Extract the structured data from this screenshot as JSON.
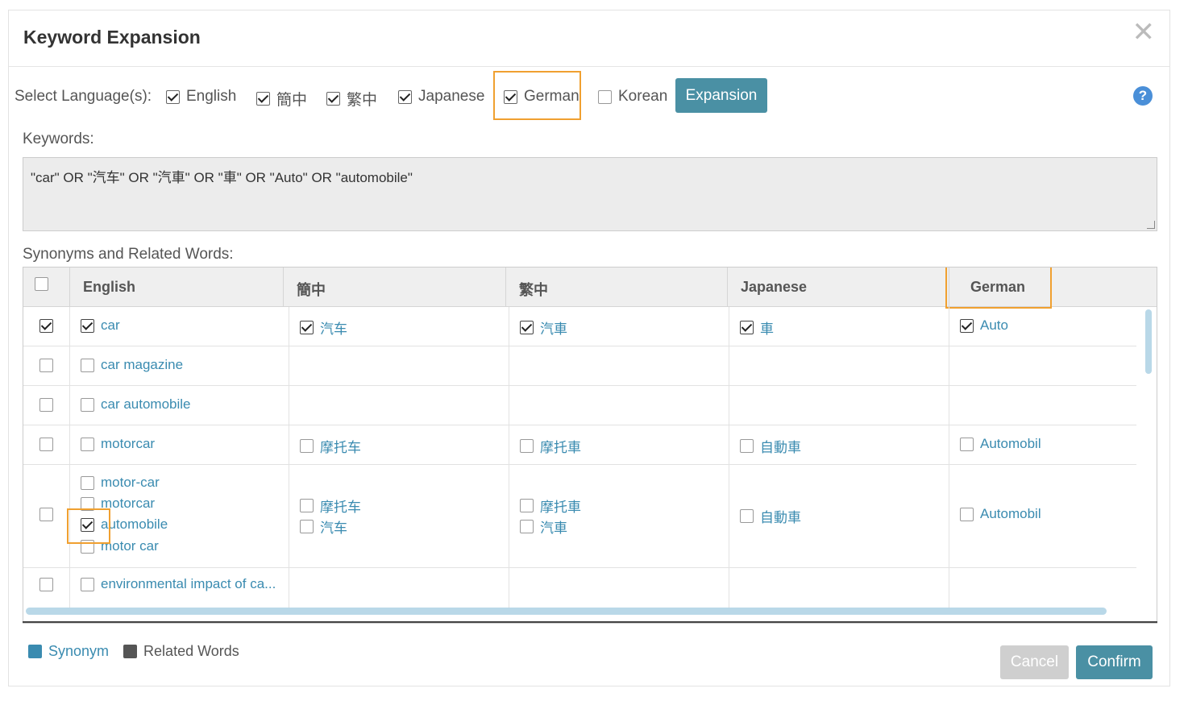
{
  "modal": {
    "title": "Keyword Expansion",
    "close_label": "✕"
  },
  "language_select": {
    "label": "Select Language(s):",
    "options": [
      {
        "label": "English",
        "checked": true
      },
      {
        "label": "簡中",
        "checked": true
      },
      {
        "label": "繁中",
        "checked": true
      },
      {
        "label": "Japanese",
        "checked": true
      },
      {
        "label": "German",
        "checked": true
      },
      {
        "label": "Korean",
        "checked": false
      }
    ],
    "expansion_button": "Expansion",
    "help_label": "?"
  },
  "keywords": {
    "label": "Keywords:",
    "value": "\"car\" OR \"汽车\" OR \"汽車\" OR \"車\" OR \"Auto\" OR \"automobile\""
  },
  "synonyms": {
    "label": "Synonyms and Related Words:",
    "columns": [
      "English",
      "簡中",
      "繁中",
      "Japanese",
      "German"
    ],
    "rows": [
      {
        "selected": true,
        "english": [
          {
            "text": "car",
            "checked": true
          }
        ],
        "zh_cn": [
          {
            "text": "汽车",
            "checked": true
          }
        ],
        "zh_tw": [
          {
            "text": "汽車",
            "checked": true
          }
        ],
        "japanese": [
          {
            "text": "車",
            "checked": true
          }
        ],
        "german": [
          {
            "text": "Auto",
            "checked": true
          }
        ]
      },
      {
        "selected": false,
        "english": [
          {
            "text": "car magazine",
            "checked": false
          }
        ],
        "zh_cn": [],
        "zh_tw": [],
        "japanese": [],
        "german": []
      },
      {
        "selected": false,
        "english": [
          {
            "text": "car automobile",
            "checked": false
          }
        ],
        "zh_cn": [],
        "zh_tw": [],
        "japanese": [],
        "german": []
      },
      {
        "selected": false,
        "english": [
          {
            "text": "motorcar",
            "checked": false
          }
        ],
        "zh_cn": [
          {
            "text": "摩托车",
            "checked": false
          }
        ],
        "zh_tw": [
          {
            "text": "摩托車",
            "checked": false
          }
        ],
        "japanese": [
          {
            "text": "自動車",
            "checked": false
          }
        ],
        "german": [
          {
            "text": "Automobil",
            "checked": false
          }
        ]
      },
      {
        "selected": false,
        "english": [
          {
            "text": "motor-car",
            "checked": false
          },
          {
            "text": "motorcar",
            "checked": false
          },
          {
            "text": "automobile",
            "checked": true
          },
          {
            "text": "motor car",
            "checked": false
          }
        ],
        "zh_cn": [
          {
            "text": "摩托车",
            "checked": false
          },
          {
            "text": "汽车",
            "checked": false
          }
        ],
        "zh_tw": [
          {
            "text": "摩托車",
            "checked": false
          },
          {
            "text": "汽車",
            "checked": false
          }
        ],
        "japanese": [
          {
            "text": "自動車",
            "checked": false
          }
        ],
        "german": [
          {
            "text": "Automobil",
            "checked": false
          }
        ]
      },
      {
        "selected": false,
        "english": [
          {
            "text": "environmental impact of ca...",
            "checked": false
          }
        ],
        "zh_cn": [],
        "zh_tw": [],
        "japanese": [],
        "german": []
      }
    ]
  },
  "legend": {
    "synonym": "Synonym",
    "related": "Related Words",
    "synonym_color": "#3a8bb0",
    "related_color": "#555555"
  },
  "footer": {
    "cancel": "Cancel",
    "confirm": "Confirm"
  },
  "colors": {
    "accent": "#4a90a4",
    "highlight": "#f0a030",
    "link": "#3a8bb0"
  }
}
